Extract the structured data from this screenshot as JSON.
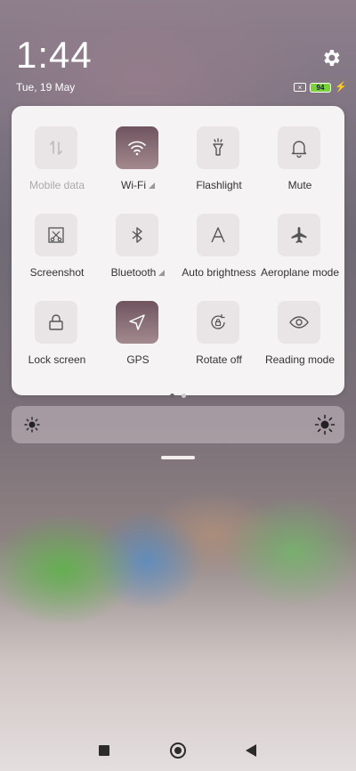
{
  "status": {
    "time": "1:44",
    "date": "Tue, 19 May",
    "battery_level": "94",
    "sim_mark": "×"
  },
  "tiles": [
    {
      "label": "Mobile data",
      "icon": "mobile-data-icon",
      "active": false,
      "disabled": true
    },
    {
      "label": "Wi-Fi",
      "icon": "wifi-icon",
      "active": true
    },
    {
      "label": "Flashlight",
      "icon": "flashlight-icon",
      "active": false
    },
    {
      "label": "Mute",
      "icon": "bell-icon",
      "active": false
    },
    {
      "label": "Screenshot",
      "icon": "screenshot-icon",
      "active": false
    },
    {
      "label": "Bluetooth",
      "icon": "bluetooth-icon",
      "active": false
    },
    {
      "label": "Auto brightness",
      "icon": "auto-brightness-icon",
      "active": false
    },
    {
      "label": "Aeroplane mode",
      "icon": "airplane-icon",
      "active": false
    },
    {
      "label": "Lock screen",
      "icon": "lock-icon",
      "active": false
    },
    {
      "label": "GPS",
      "icon": "gps-icon",
      "active": true
    },
    {
      "label": "Rotate off",
      "icon": "rotate-lock-icon",
      "active": false
    },
    {
      "label": "Reading mode",
      "icon": "eye-icon",
      "active": false
    }
  ],
  "pager": {
    "pages": 2,
    "current": 1
  },
  "colors": {
    "active_tile": "#6f5460",
    "battery": "#7ad23a"
  }
}
